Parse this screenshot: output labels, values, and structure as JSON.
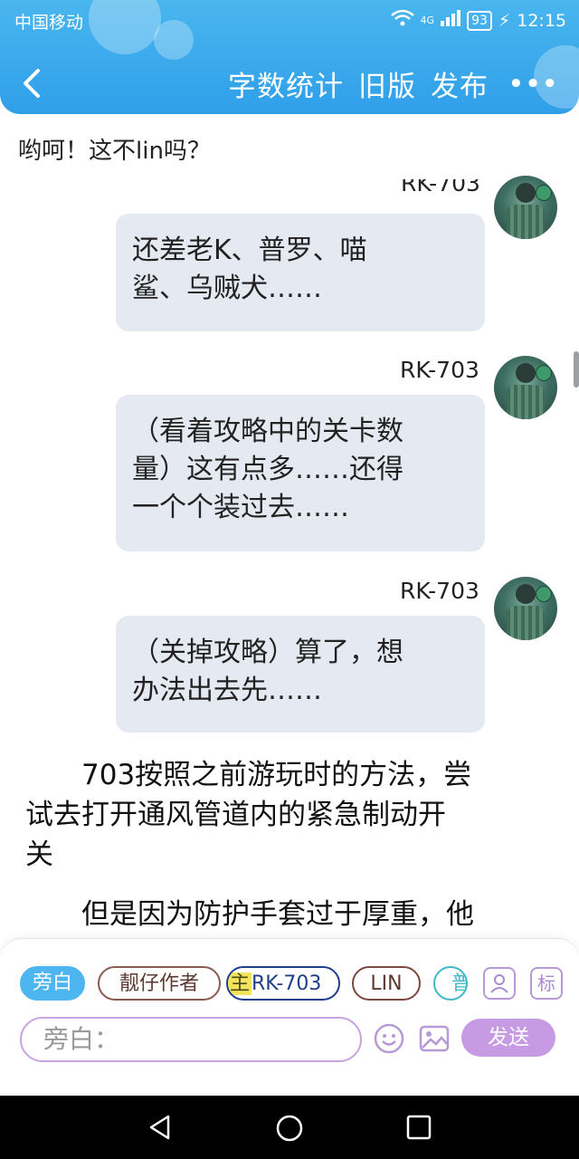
{
  "status_bar": {
    "carrier": "中国移动",
    "network": "4G",
    "battery": "93",
    "time": "12:15"
  },
  "header": {
    "actions": [
      "字数统计",
      "旧版",
      "发布"
    ],
    "more": "•••"
  },
  "greeting": "哟呵！这不lin吗？",
  "messages": [
    {
      "name": "RK-703",
      "text_lines": [
        "还差老K、普罗、喵",
        "鲨、乌贼犬……"
      ]
    },
    {
      "name": "RK-703",
      "text_lines": [
        "（看着攻略中的关卡数",
        "量）这有点多……还得",
        "一个个装过去……"
      ]
    },
    {
      "name": "RK-703",
      "text_lines": [
        "（关掉攻略）算了，想",
        "办法出去先……"
      ]
    }
  ],
  "narration": [
    {
      "lines": [
        "703按照之前游玩时的方法，尝",
        "试去打开通风管道内的紧急制动开",
        "关"
      ]
    },
    {
      "lines": [
        "但是因为防护手套过于厚重，他"
      ]
    }
  ],
  "composer": {
    "roles": [
      "旁白",
      "靓仔作者",
      "RK-703",
      "LIN",
      "普"
    ],
    "role_main_marker": "主",
    "contacts_icon": "contacts-icon",
    "tag_button": "标",
    "input_placeholder": "旁白：",
    "send_label": "发送"
  },
  "colors": {
    "header": "#3aa8ec",
    "bubble": "#e5e9f1",
    "send": "#c79be3"
  }
}
